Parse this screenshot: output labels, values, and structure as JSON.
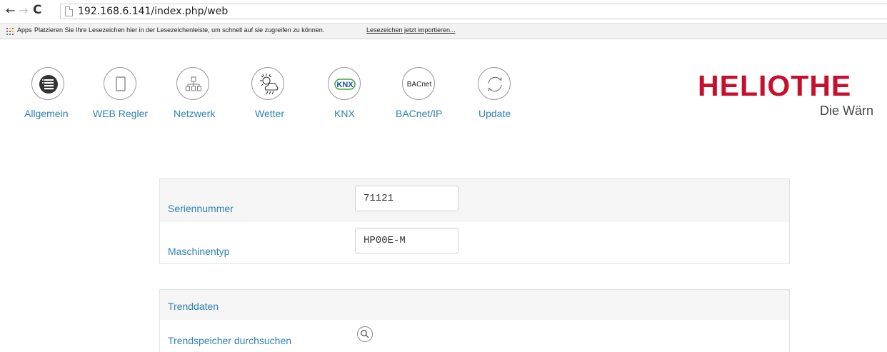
{
  "browser": {
    "nav_back": "←",
    "nav_forward": "→",
    "nav_reload": "C",
    "url": "192.168.6.141/index.php/web",
    "bookmarks": {
      "apps_label": "Apps",
      "text": "Platzieren Sie Ihre Lesezeichen hier in der Lesezeichenleiste, um schnell auf sie zugreifen zu können.",
      "link": "Lesezeichen jetzt importieren..."
    }
  },
  "nav": {
    "items": [
      {
        "label": "Allgemein",
        "icon": "list-icon"
      },
      {
        "label": "WEB Regler",
        "icon": "tablet-icon"
      },
      {
        "label": "Netzwerk",
        "icon": "network-icon"
      },
      {
        "label": "Wetter",
        "icon": "weather-icon"
      },
      {
        "label": "KNX",
        "icon": "knx-icon",
        "icon_text": "KNX"
      },
      {
        "label": "BACnet/IP",
        "icon": "bacnet-icon",
        "icon_text": "BACnet"
      },
      {
        "label": "Update",
        "icon": "refresh-icon"
      }
    ]
  },
  "brand": {
    "logo": "HELIOTHE",
    "slogan": "Die Wärn",
    "logo_color": "#c8102e"
  },
  "machine_panel": {
    "serial_label": "Seriennummer",
    "serial_value": "71121",
    "type_label": "Maschinentyp",
    "type_value": "HP00E-M"
  },
  "trend_panel": {
    "title": "Trenddaten",
    "search_label": "Trendspeicher durchsuchen",
    "search_icon": "magnifier-icon"
  },
  "colors": {
    "link_blue": "#2d83b0",
    "row_shade": "#f5f5f5",
    "knx_green": "#3fa33f",
    "knx_blue": "#1a4f9c"
  }
}
